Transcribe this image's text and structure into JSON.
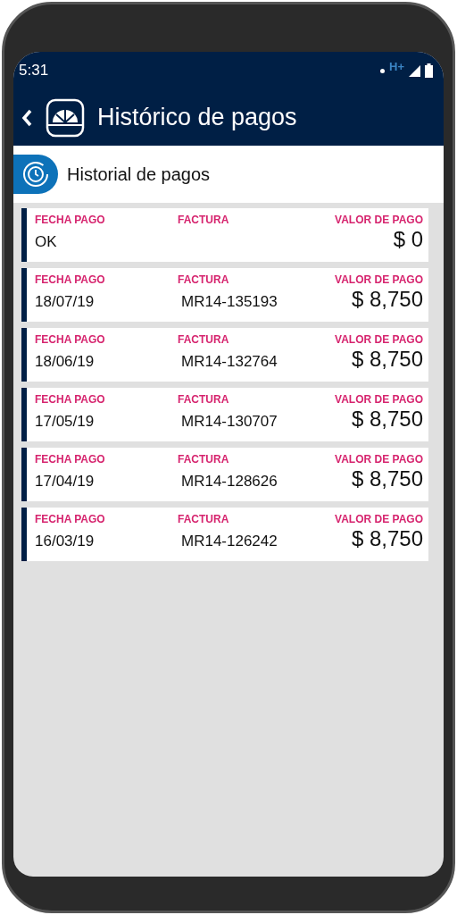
{
  "status_bar": {
    "time": "5:31",
    "network": "H+"
  },
  "app_bar": {
    "title": "Histórico de pagos"
  },
  "section": {
    "title": "Historial de pagos"
  },
  "payments": [
    {
      "date_label": "FECHA PAGO",
      "invoice_label": "FACTURA",
      "amount_label": "VALOR DE PAGO",
      "date": "OK",
      "amount": "$ 0"
    },
    {
      "date_label": "FECHA PAGO",
      "invoice_label": "FACTURA",
      "amount_label": "VALOR DE PAGO",
      "date": "18/07/19",
      "invoice": "MR14-135193",
      "amount": "$ 8,750"
    },
    {
      "date_label": "FECHA PAGO",
      "invoice_label": "FACTURA",
      "amount_label": "VALOR DE PAGO",
      "date": "18/06/19",
      "invoice": "MR14-132764",
      "amount": "$ 8,750"
    },
    {
      "date_label": "FECHA PAGO",
      "invoice_label": "FACTURA",
      "amount_label": "VALOR DE PAGO",
      "date": "17/05/19",
      "invoice": "MR14-130707",
      "amount": "$ 8,750"
    },
    {
      "date_label": "FECHA PAGO",
      "invoice_label": "FACTURA",
      "amount_label": "VALOR DE PAGO",
      "date": "17/04/19",
      "invoice": "MR14-128626",
      "amount": "$ 8,750"
    },
    {
      "date_label": "FECHA PAGO",
      "invoice_label": "FACTURA",
      "amount_label": "VALOR DE PAGO",
      "date": "16/03/19",
      "invoice": "MR14-126242",
      "amount": "$ 8,750"
    }
  ]
}
